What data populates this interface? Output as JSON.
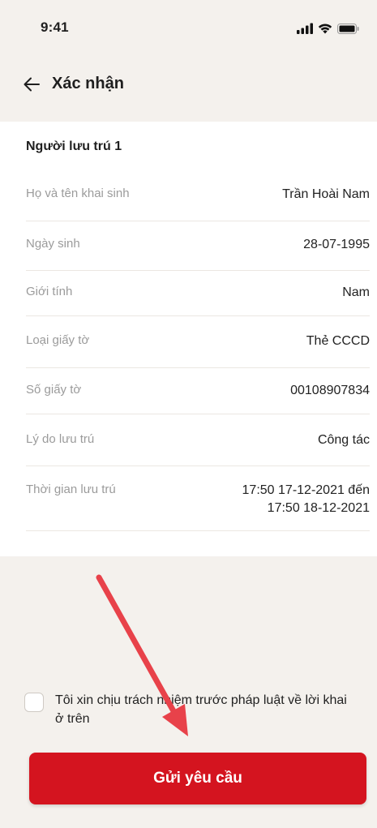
{
  "status_bar": {
    "time": "9:41",
    "icons": [
      "signal-icon",
      "wifi-icon",
      "battery-icon"
    ]
  },
  "header": {
    "back_icon": "arrow-left-icon",
    "title": "Xác nhận"
  },
  "section": {
    "title": "Người lưu trú 1",
    "rows": [
      {
        "label": "Họ và tên khai sinh",
        "value": "Trần Hoài Nam"
      },
      {
        "label": "Ngày sinh",
        "value": "28-07-1995"
      },
      {
        "label": "Giới tính",
        "value": "Nam"
      },
      {
        "label": "Loại giấy tờ",
        "value": "Thẻ CCCD"
      },
      {
        "label": "Số giấy tờ",
        "value": "00108907834"
      },
      {
        "label": "Lý do lưu trú",
        "value": "Công tác"
      },
      {
        "label": "Thời gian lưu trú",
        "value_line1": "17:50 17-12-2021 đến",
        "value_line2": "17:50 18-12-2021"
      }
    ]
  },
  "agreement": {
    "checked": false,
    "text": "Tôi xin chịu trách nhiệm trước pháp luật về lời khai ở trên"
  },
  "submit": {
    "label": "Gửi yêu cầu"
  },
  "colors": {
    "accent": "#d4141f",
    "background": "#f4f1ed",
    "label": "#9b9b9b",
    "annotation_arrow": "#e8424a"
  }
}
